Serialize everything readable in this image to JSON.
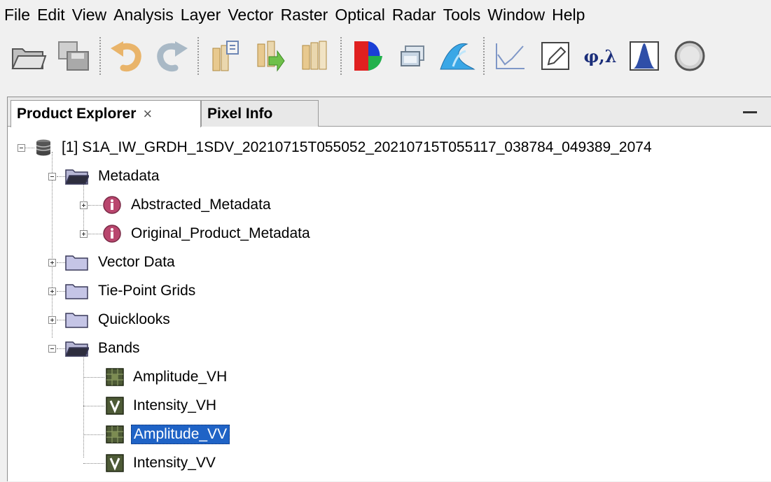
{
  "menu": [
    "File",
    "Edit",
    "View",
    "Analysis",
    "Layer",
    "Vector",
    "Raster",
    "Optical",
    "Radar",
    "Tools",
    "Window",
    "Help"
  ],
  "toolbar": {
    "icons": [
      "open-folder-icon",
      "save-icon",
      "undo-icon",
      "redo-icon",
      "import-vector-icon",
      "export-icon",
      "session-icon",
      "rgb-image-icon",
      "window-icon",
      "wave-icon",
      "plot-icon",
      "pencil-icon",
      "geo-coordinates-icon",
      "histogram-icon",
      "info-icon"
    ],
    "geo_label": "φ,λ"
  },
  "panel": {
    "tabs": [
      {
        "label": "Product Explorer",
        "close": "×"
      },
      {
        "label": "Pixel Info"
      }
    ]
  },
  "tree": {
    "product": "[1] S1A_IW_GRDH_1SDV_20210715T055052_20210715T055117_038784_049389_2074",
    "metadata": {
      "label": "Metadata",
      "children": [
        "Abstracted_Metadata",
        "Original_Product_Metadata"
      ]
    },
    "folders": [
      "Vector Data",
      "Tie-Point Grids",
      "Quicklooks"
    ],
    "bands": {
      "label": "Bands",
      "children": [
        "Amplitude_VH",
        "Intensity_VH",
        "Amplitude_VV",
        "Intensity_VV"
      ],
      "selected": "Amplitude_VV"
    }
  }
}
